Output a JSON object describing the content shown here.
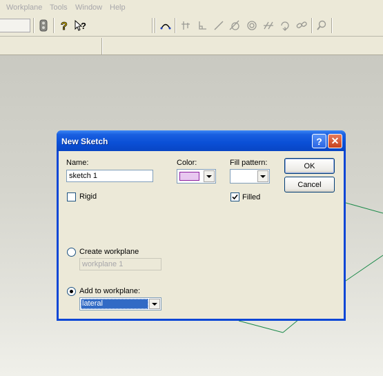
{
  "menubar": {
    "items": [
      "Workplane",
      "Tools",
      "Window",
      "Help"
    ]
  },
  "toolbar": {
    "icons": [
      "traffic-light-icon",
      "help-question-icon",
      "context-help-icon",
      "sketch-arc-icon",
      "snap-grid-icon",
      "perpendicular-icon",
      "line-icon",
      "tangent-icon",
      "concentric-icon",
      "parallel-icon",
      "rotate-icon",
      "link-icon",
      "zoom-icon"
    ]
  },
  "dialog": {
    "title": "New Sketch",
    "name_label": "Name:",
    "name_value": "sketch 1",
    "color_label": "Color:",
    "color_value": "#e8c8f0",
    "fill_label": "Fill pattern:",
    "rigid_label": "Rigid",
    "rigid_checked": false,
    "filled_label": "Filled",
    "filled_checked": true,
    "create_workplane_label": "Create workplane",
    "create_workplane_value": "workplane 1",
    "add_to_workplane_label": "Add to workplane:",
    "add_to_workplane_value": "lateral",
    "selected_option": "add_to_workplane",
    "ok_label": "OK",
    "cancel_label": "Cancel",
    "help_button": "?",
    "close_button": "✕"
  },
  "colors": {
    "accent": "#0a46d6",
    "selection": "#316ac5",
    "sketch_line": "#1c8a4a"
  }
}
